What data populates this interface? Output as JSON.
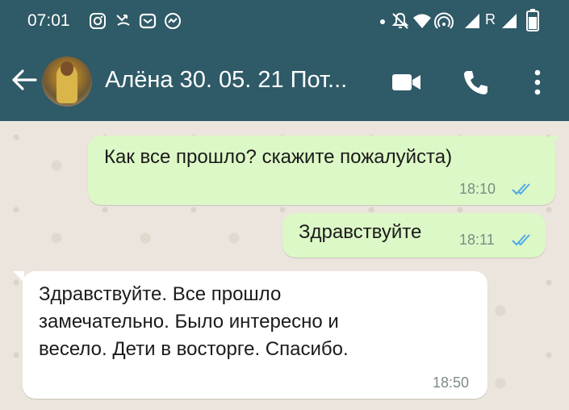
{
  "status_bar": {
    "time": "07:01",
    "icons": [
      "instagram-icon",
      "missed-call-icon",
      "message-icon",
      "messenger-icon",
      "dot-icon",
      "mute-icon",
      "wifi-icon",
      "hotspot-icon",
      "signal-icon",
      "roaming-signal-icon",
      "battery-icon"
    ],
    "roaming_label": "R"
  },
  "header": {
    "title": "Алёна 30. 05. 21 Пот...",
    "icons": [
      "back-arrow-icon",
      "avatar",
      "video-call-icon",
      "voice-call-icon",
      "more-options-icon"
    ]
  },
  "messages": [
    {
      "direction": "outgoing",
      "text": "Как все прошло? скажите пожалуйста)",
      "time": "18:10",
      "status": "read"
    },
    {
      "direction": "outgoing",
      "text": "Здравствуйте",
      "time": "18:11",
      "status": "read"
    },
    {
      "direction": "incoming",
      "lines": [
        "Здравствуйте. Все прошло",
        "замечательно. Было интересно и",
        "весело. Дети в восторге. Спасибо."
      ],
      "time": "18:50"
    }
  ],
  "colors": {
    "header_bg": "#2f5a67",
    "outgoing_bubble": "#dcf8c6",
    "incoming_bubble": "#ffffff",
    "chat_background": "#ece5dd",
    "read_ticks": "#4fa8e8"
  }
}
